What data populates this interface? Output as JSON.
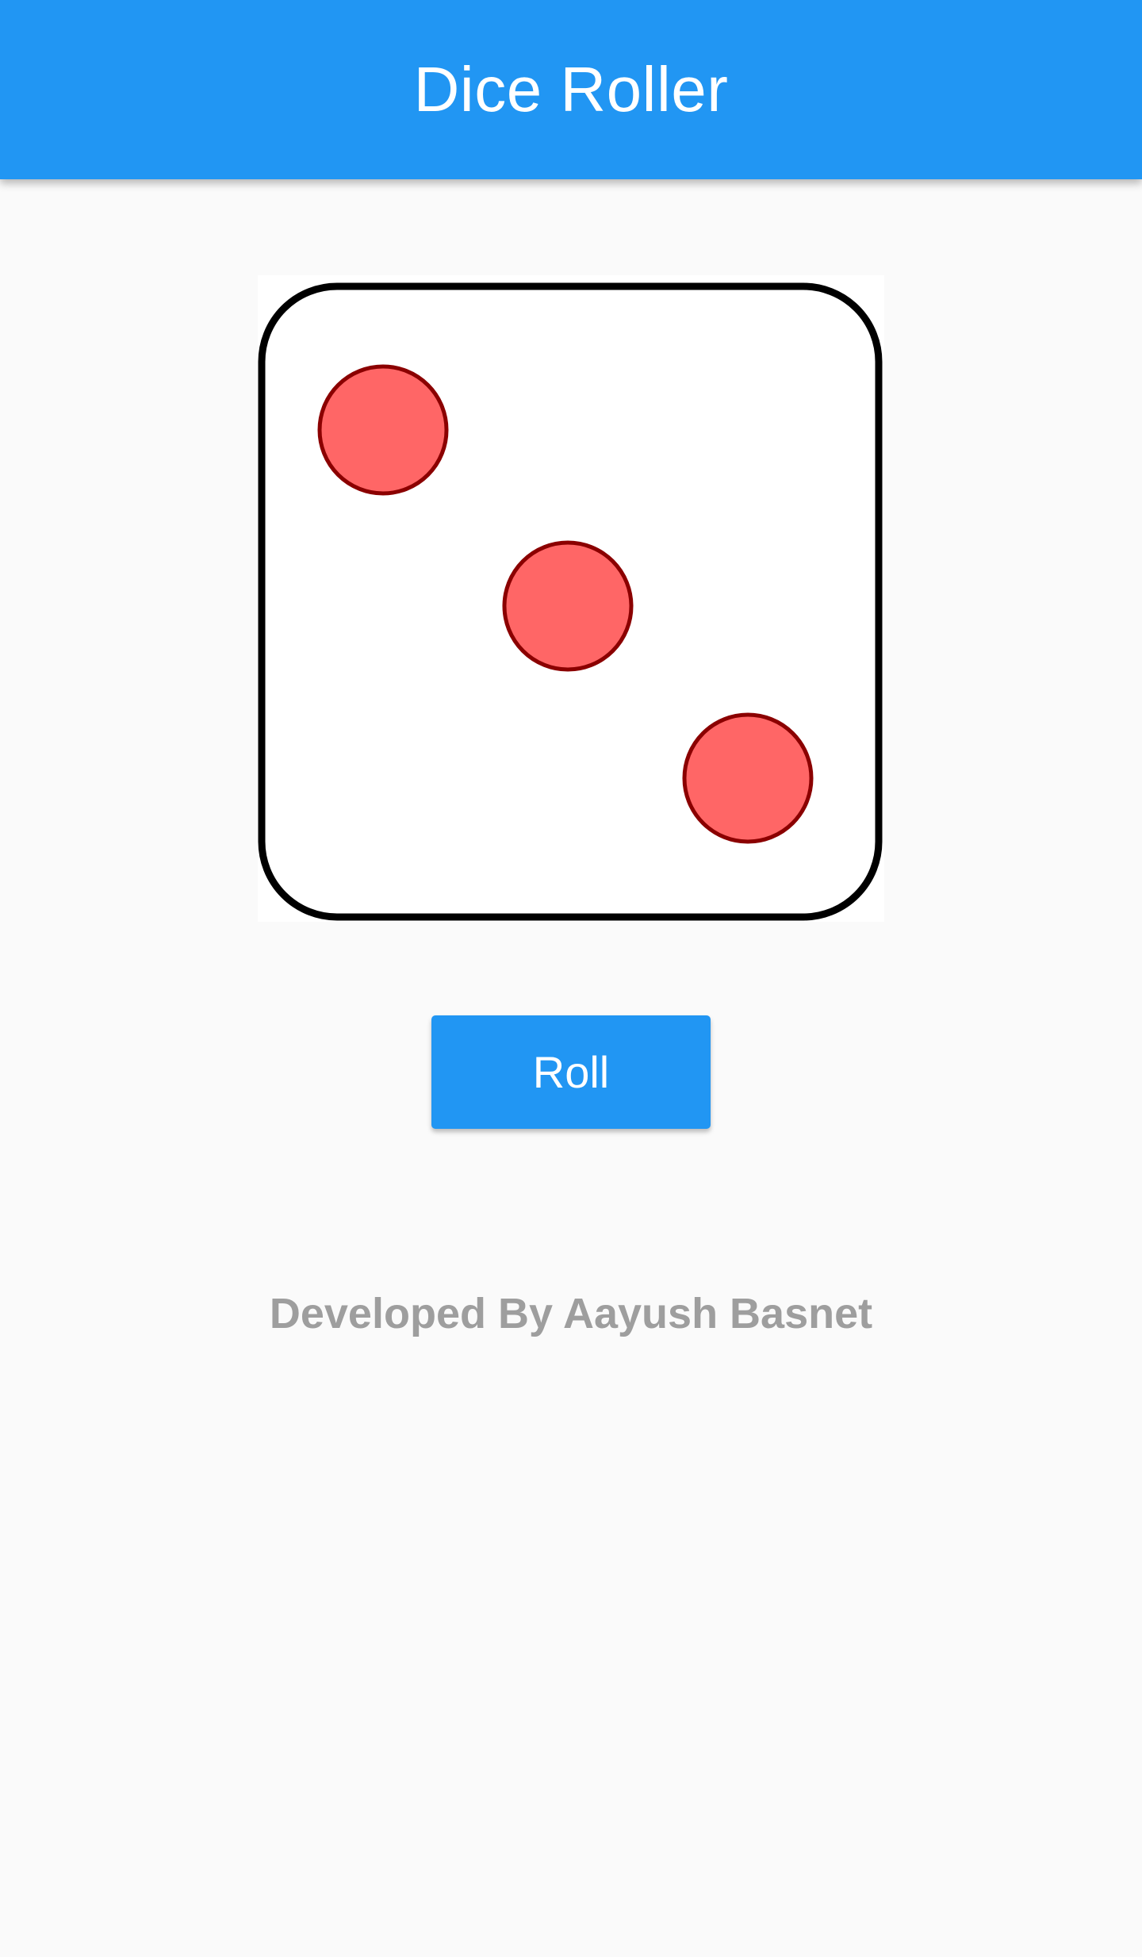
{
  "app_bar": {
    "title": "Dice Roller",
    "color": "#2196f3"
  },
  "dice": {
    "face_value": 3,
    "pip_color": "#ff6666",
    "pip_outline": "#8b0000",
    "border_color": "#000000"
  },
  "roll_button": {
    "label": "Roll",
    "color": "#2196f3"
  },
  "footer": {
    "credit": "Developed By Aayush Basnet",
    "color": "#9e9e9e"
  }
}
